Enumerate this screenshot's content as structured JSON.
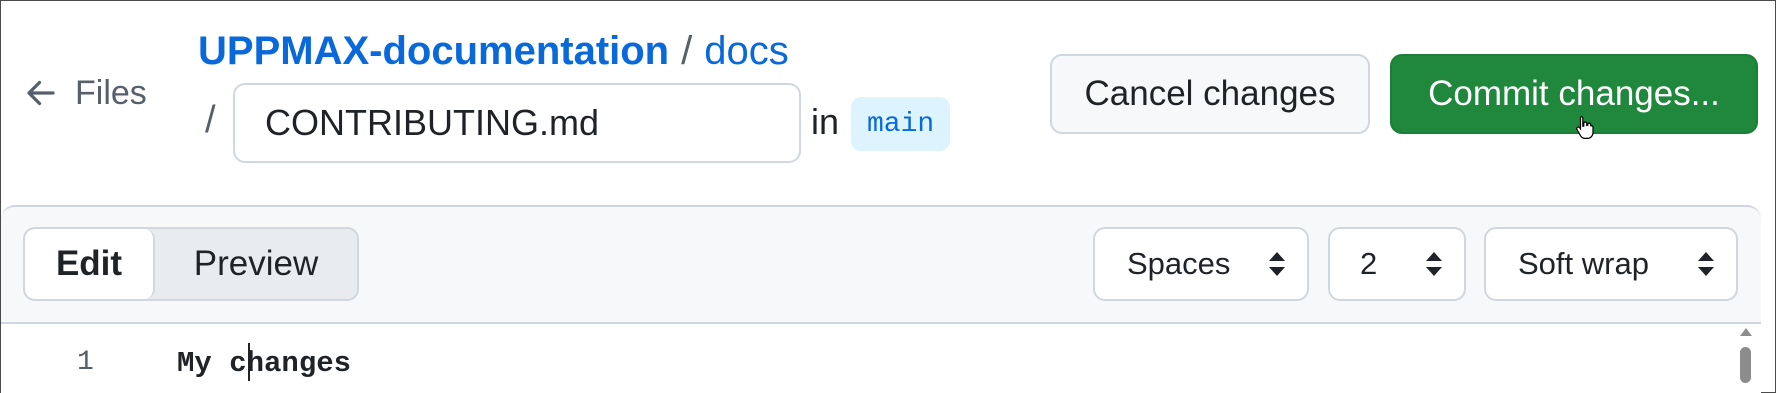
{
  "header": {
    "back_label": "Files",
    "repo": "UPPMAX-documentation",
    "separator": "/",
    "folder": "docs",
    "path_separator": "/",
    "filename": "CONTRIBUTING.md",
    "in_label": "in",
    "branch": "main"
  },
  "actions": {
    "cancel_label": "Cancel changes",
    "commit_label": "Commit changes..."
  },
  "editor": {
    "tabs": [
      {
        "label": "Edit",
        "active": true
      },
      {
        "label": "Preview",
        "active": false
      }
    ],
    "indent_mode": "Spaces",
    "indent_size": "2",
    "wrap_mode": "Soft wrap",
    "lines": [
      {
        "number": "1",
        "text": "My changes"
      }
    ]
  },
  "colors": {
    "accent": "#0969da",
    "commit_green": "#1f883d",
    "branch_bg": "#ddf4ff"
  }
}
